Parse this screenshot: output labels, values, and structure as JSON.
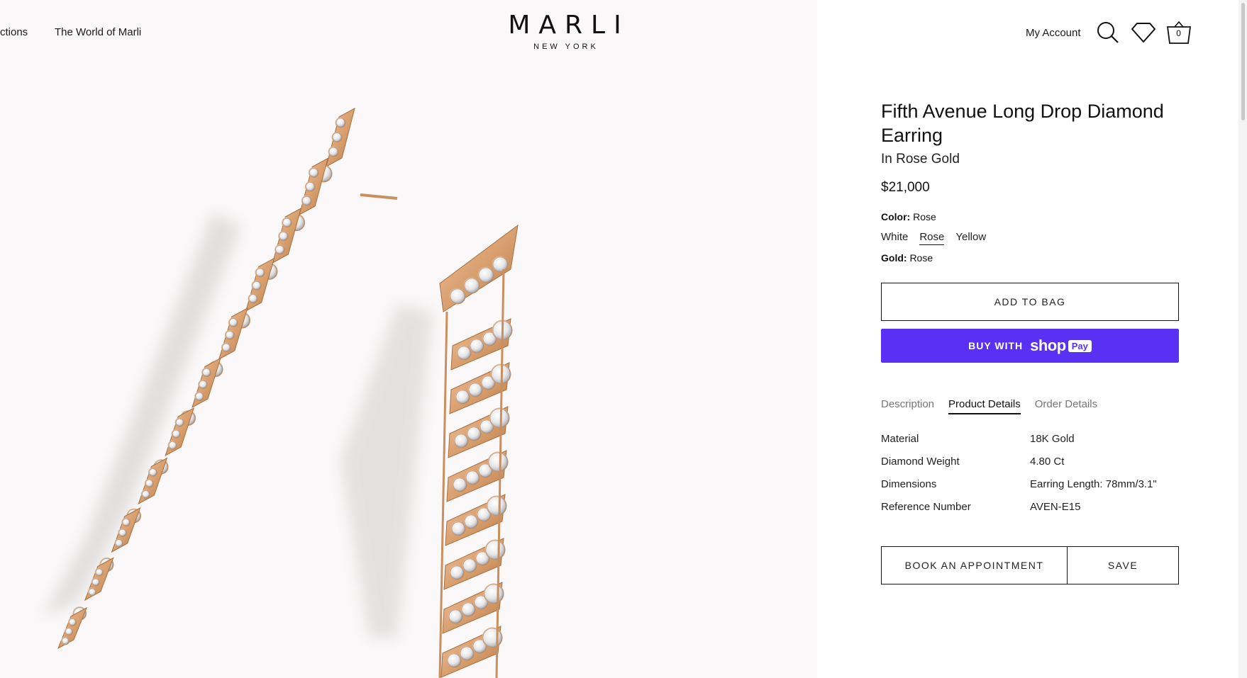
{
  "header": {
    "nav_left": [
      "ctions",
      "The World of Marli"
    ],
    "logo_main": "MARLI",
    "logo_sub": "NEW YORK",
    "account_label": "My Account",
    "icons": [
      "search-icon",
      "heart-icon",
      "cart-icon"
    ],
    "cart_count": "0"
  },
  "product": {
    "title": "Fifth Avenue Long Drop Diamond Earring",
    "subtitle": "In Rose Gold",
    "price": "$21,000",
    "color_label": "Color:",
    "color_value": "Rose",
    "color_options": [
      "White",
      "Rose",
      "Yellow"
    ],
    "selected_color": "Rose",
    "gold_label": "Gold:",
    "gold_value": "Rose",
    "add_to_bag": "ADD TO BAG",
    "shop_pay": {
      "buy_with": "BUY WITH",
      "shop": "shop",
      "pay": "Pay"
    },
    "tabs": [
      "Description",
      "Product Details",
      "Order Details"
    ],
    "active_tab": "Product Details",
    "details": [
      {
        "label": "Material",
        "value": "18K Gold"
      },
      {
        "label": "Diamond Weight",
        "value": "4.80 Ct"
      },
      {
        "label": "Dimensions",
        "value": "Earring Length: 78mm/3.1\""
      },
      {
        "label": "Reference Number",
        "value": "AVEN-E15"
      }
    ],
    "book_appointment": "BOOK AN APPOINTMENT",
    "save": "SAVE"
  },
  "colors": {
    "image_bg": "#faf8f8",
    "shop_pay_purple": "#5a31f4",
    "rose_gold": "#d9a070"
  }
}
